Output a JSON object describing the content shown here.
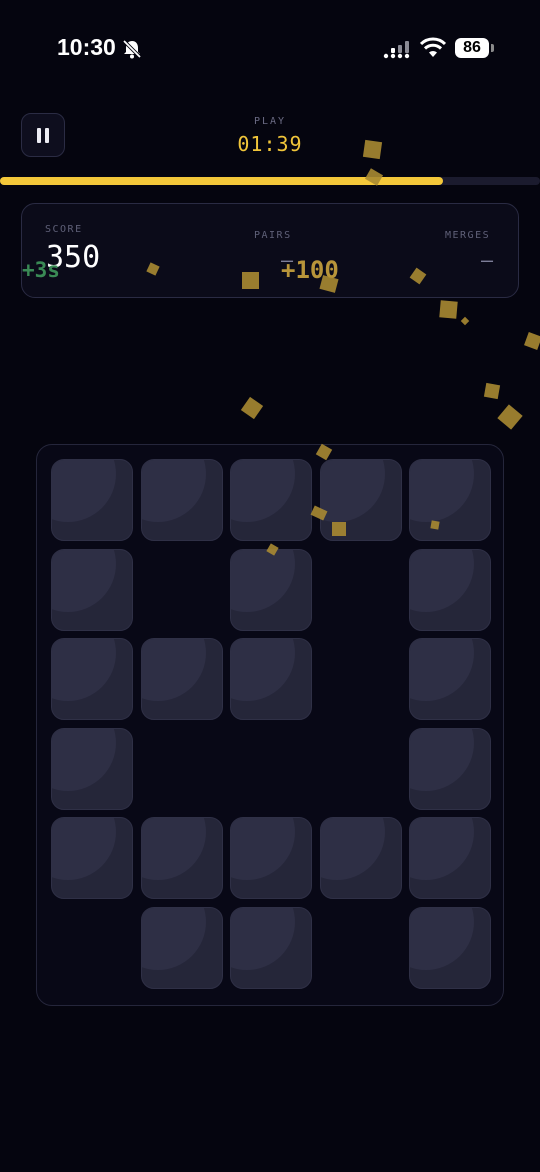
{
  "status_bar": {
    "time": "10:30",
    "battery": "86",
    "icons": [
      "bell-off-icon",
      "signal-icon",
      "wifi-icon",
      "battery-icon"
    ]
  },
  "header": {
    "mode_label": "PLAY",
    "timer": "01:39",
    "progress_fraction": 0.82,
    "pause_icon": "pause-icon"
  },
  "stats": {
    "score_label": "SCORE",
    "score_value": "350",
    "pairs_label": "PAIRS",
    "pairs_value": "—",
    "merges_label": "MERGES",
    "merges_value": "—"
  },
  "popups": {
    "time_bonus": "+3s",
    "score_bonus": "+100"
  },
  "board": {
    "rows": 6,
    "cols": 5,
    "tiles": [
      [
        1,
        1,
        1,
        1,
        1
      ],
      [
        1,
        0,
        1,
        0,
        1
      ],
      [
        1,
        1,
        1,
        0,
        1
      ],
      [
        1,
        0,
        0,
        0,
        1
      ],
      [
        1,
        1,
        1,
        1,
        1
      ],
      [
        0,
        1,
        1,
        0,
        1
      ]
    ]
  },
  "colors": {
    "background": "#05050f",
    "accent": "#f4c83a",
    "tile": "#252639",
    "bonus_green": "#3a8a55",
    "bonus_gold": "#b8953a"
  }
}
